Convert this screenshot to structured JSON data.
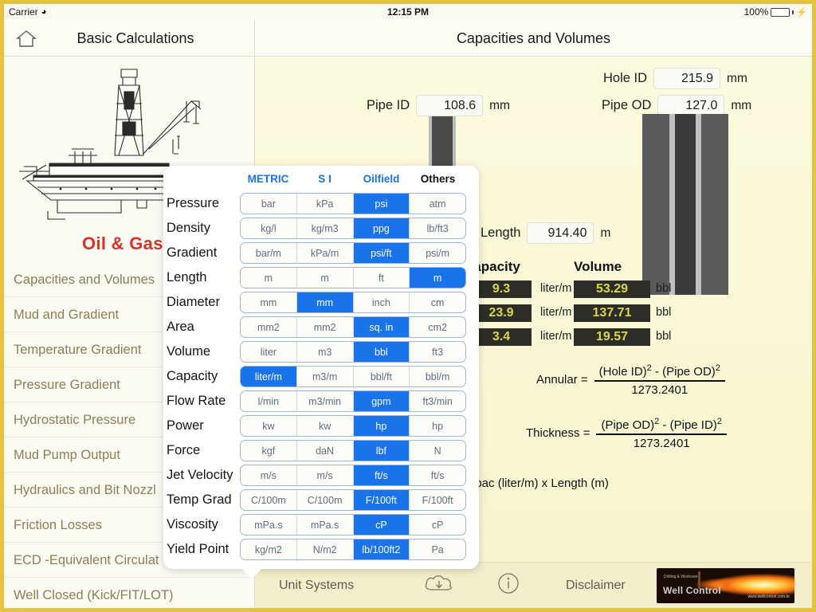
{
  "statusbar": {
    "carrier": "Carrier",
    "wifi_icon": "wifi-icon",
    "time": "12:15 PM",
    "battery_pct": "100%"
  },
  "navbar": {
    "home_icon": "home-icon",
    "left_title": "Basic Calculations",
    "right_title": "Capacities and Volumes"
  },
  "sidebar": {
    "brand": "Oil & Gas",
    "rig_image": "oil-rig-illustration",
    "items": [
      {
        "label": "Capacities and Volumes"
      },
      {
        "label": "Mud and Gradient"
      },
      {
        "label": "Temperature Gradient"
      },
      {
        "label": "Pressure Gradient"
      },
      {
        "label": "Hydrostatic Pressure"
      },
      {
        "label": "Mud Pump Output"
      },
      {
        "label": "Hydraulics and Bit Nozzl"
      },
      {
        "label": "Friction Losses"
      },
      {
        "label": "ECD -Equivalent Circulat"
      },
      {
        "label": "Well Closed (Kick/FIT/LOT)"
      }
    ]
  },
  "main": {
    "inputs": [
      {
        "label": "Pipe ID",
        "value": "108.6",
        "unit": "mm"
      },
      {
        "label": "Hole ID",
        "value": "215.9",
        "unit": "mm"
      },
      {
        "label": "Pipe OD",
        "value": "127.0",
        "unit": "mm"
      },
      {
        "label": "Length",
        "value": "914.40",
        "unit": "m"
      }
    ],
    "capacity_header": "Capacity",
    "volume_header": "Volume",
    "results": [
      {
        "capacity": "9.3",
        "capacity_unit": "liter/m",
        "volume": "53.29",
        "volume_unit": "bbl"
      },
      {
        "capacity": "23.9",
        "capacity_unit": "liter/m",
        "volume": "137.71",
        "volume_unit": "bbl"
      },
      {
        "capacity": "3.4",
        "capacity_unit": "liter/m",
        "volume": "19.57",
        "volume_unit": "bbl"
      }
    ],
    "formulas": [
      {
        "name": "Annular =",
        "numerator_a": "(Hole ID)",
        "exp_a": "2",
        "op": "-",
        "numerator_b": "(Pipe OD)",
        "exp_b": "2",
        "denominator": "1273.2401"
      },
      {
        "name": "Thickness =",
        "numerator_a": "(Pipe OD)",
        "exp_a": "2",
        "op": "-",
        "numerator_b": "(Pipe ID)",
        "exp_b": "2",
        "denominator": "1273.2401"
      }
    ],
    "footnote": "apac (liter/m) x Length (m)"
  },
  "popup": {
    "columns": [
      "METRIC",
      "S I",
      "Oilfield",
      "Others"
    ],
    "rows": [
      {
        "label": "Pressure",
        "cells": [
          "bar",
          "kPa",
          "psi",
          "atm"
        ],
        "selected": 2
      },
      {
        "label": "Density",
        "cells": [
          "kg/l",
          "kg/m3",
          "ppg",
          "lb/ft3"
        ],
        "selected": 2
      },
      {
        "label": "Gradient",
        "cells": [
          "bar/m",
          "kPa/m",
          "psi/ft",
          "psi/m"
        ],
        "selected": 2
      },
      {
        "label": "Length",
        "cells": [
          "m",
          "m",
          "ft",
          "m"
        ],
        "selected": 3
      },
      {
        "label": "Diameter",
        "cells": [
          "mm",
          "mm",
          "inch",
          "cm"
        ],
        "selected": 1
      },
      {
        "label": "Area",
        "cells": [
          "mm2",
          "mm2",
          "sq. in",
          "cm2"
        ],
        "selected": 2
      },
      {
        "label": "Volume",
        "cells": [
          "liter",
          "m3",
          "bbl",
          "ft3"
        ],
        "selected": 2
      },
      {
        "label": "Capacity",
        "cells": [
          "liter/m",
          "m3/m",
          "bbl/ft",
          "bbl/m"
        ],
        "selected": 0
      },
      {
        "label": "Flow Rate",
        "cells": [
          "l/min",
          "m3/min",
          "gpm",
          "ft3/min"
        ],
        "selected": 2
      },
      {
        "label": "Power",
        "cells": [
          "kw",
          "kw",
          "hp",
          "hp"
        ],
        "selected": 2
      },
      {
        "label": "Force",
        "cells": [
          "kgf",
          "daN",
          "lbf",
          "N"
        ],
        "selected": 2
      },
      {
        "label": "Jet Velocity",
        "cells": [
          "m/s",
          "m/s",
          "ft/s",
          "ft/s"
        ],
        "selected": 2
      },
      {
        "label": "Temp Grad",
        "cells": [
          "C/100m",
          "C/100m",
          "F/100ft",
          "F/100ft"
        ],
        "selected": 2
      },
      {
        "label": "Viscosity",
        "cells": [
          "mPa.s",
          "mPa.s",
          "cP",
          "cP"
        ],
        "selected": 2
      },
      {
        "label": "Yield Point",
        "cells": [
          "kg/m2",
          "N/m2",
          "lb/100ft2",
          "Pa"
        ],
        "selected": 2
      }
    ]
  },
  "toolbar": {
    "unit_systems": "Unit Systems",
    "cloud_icon": "cloud-download-icon",
    "info_icon": "info-icon",
    "disclaimer": "Disclaimer",
    "ad": {
      "title": "Well Control",
      "small": "Drilling & Workover",
      "url": "www.wellcontrol.com.br"
    }
  },
  "colors": {
    "accent": "#1a73e8",
    "brand_red": "#d8322a",
    "panel": "#fbf8d9",
    "frame": "#e3c33f",
    "value_bg": "#2e2c26",
    "value_fg": "#d7d84a"
  }
}
